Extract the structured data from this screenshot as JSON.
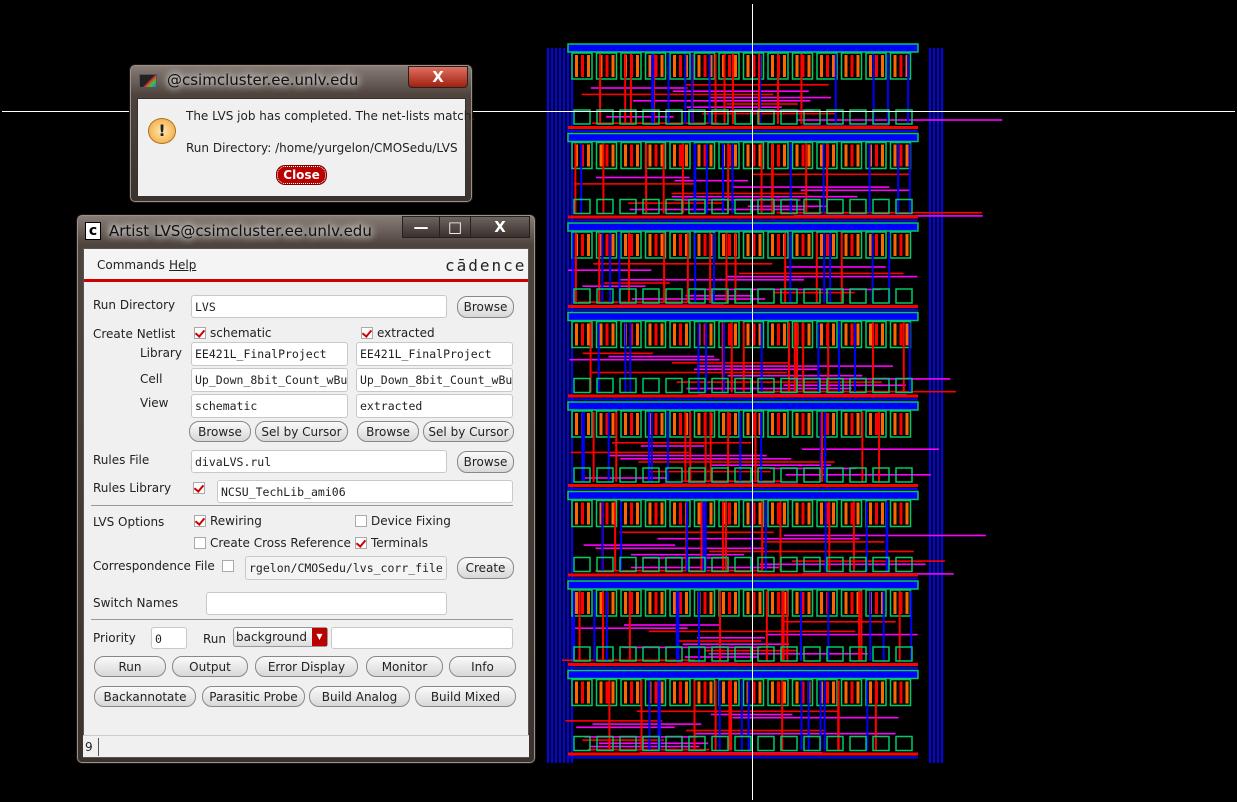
{
  "popup": {
    "title": "@csimcluster.ee.unlv.edu",
    "message": "The LVS job has completed. The net-lists match.",
    "run_directory": "Run Directory: /home/yurgelon/CMOSedu/LVS",
    "close_label": "Close",
    "x_label": "X"
  },
  "lvs": {
    "title": "Artist LVS@csimcluster.ee.unlv.edu",
    "app_icon": "c",
    "menu": {
      "commands": "Commands",
      "help": "Help"
    },
    "brand": "cādence",
    "run_directory": {
      "label": "Run Directory",
      "value": "LVS",
      "browse": "Browse"
    },
    "create_netlist": {
      "label": "Create Netlist",
      "schematic": "schematic",
      "extracted": "extracted",
      "schematic_checked": true,
      "extracted_checked": true
    },
    "library": {
      "label": "Library",
      "schematic": "EE421L_FinalProject",
      "extracted": "EE421L_FinalProject"
    },
    "cell": {
      "label": "Cell",
      "schematic": "Up_Down_8bit_Count_wBu",
      "extracted": "Up_Down_8bit_Count_wBu"
    },
    "view": {
      "label": "View",
      "schematic": "schematic",
      "extracted": "extracted"
    },
    "browse": "Browse",
    "sel_by_cursor": "Sel by Cursor",
    "rules_file": {
      "label": "Rules File",
      "value": "divaLVS.rul",
      "browse": "Browse"
    },
    "rules_library": {
      "label": "Rules Library",
      "value": "NCSU_TechLib_ami06",
      "checked": true
    },
    "lvs_options": {
      "label": "LVS Options",
      "rewiring": "Rewiring",
      "device_fixing": "Device Fixing",
      "cross_reference": "Create Cross Reference",
      "terminals": "Terminals"
    },
    "correspondence": {
      "label": "Correspondence File",
      "value": "rgelon/CMOSedu/lvs_corr_file",
      "create": "Create"
    },
    "switch_names": {
      "label": "Switch Names",
      "value": ""
    },
    "priority": {
      "label": "Priority",
      "value": "0"
    },
    "run_mode": {
      "label": "Run",
      "value": "background",
      "extra": ""
    },
    "buttons": [
      "Run",
      "Output",
      "Error Display",
      "Monitor",
      "Info",
      "Backannotate",
      "Parasitic Probe",
      "Build Analog",
      "Build Mixed"
    ],
    "status": "9"
  },
  "colors": {
    "metal1": "#0000ff",
    "poly": "#ff0000",
    "metal2": "#ff00ff",
    "active": "#00cc66",
    "select": "#ff6600"
  }
}
